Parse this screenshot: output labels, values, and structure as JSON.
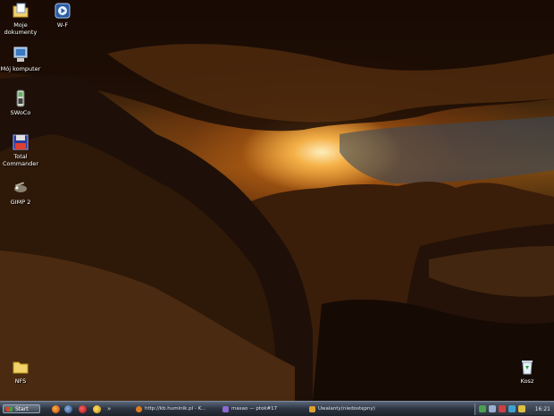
{
  "desktop_icons": [
    {
      "name": "my-documents",
      "label": "Moje\ndokumenty",
      "icon": "folder-documents-icon"
    },
    {
      "name": "wmp",
      "label": "W-F",
      "icon": "media-player-icon"
    },
    {
      "name": "my-computer",
      "label": "Mój komputer",
      "icon": "computer-icon"
    },
    {
      "name": "swoco",
      "label": "SWoCo",
      "icon": "phone-icon"
    },
    {
      "name": "total-commander",
      "label": "Total\nCommander",
      "icon": "floppy-icon"
    },
    {
      "name": "gimp",
      "label": "GIMP 2",
      "icon": "gimp-icon"
    },
    {
      "name": "nfs",
      "label": "NFS",
      "icon": "folder-icon"
    },
    {
      "name": "recycle-bin",
      "label": "Kosz",
      "icon": "recycle-bin-icon"
    }
  ],
  "taskbar": {
    "start_label": "Start",
    "quick_launch": [
      "firefox-icon",
      "network-icon",
      "opera-icon",
      "smiley-icon",
      "arrow-icon"
    ],
    "tasks": [
      {
        "label": "http://kb.huminik.pl - K...",
        "icon": "firefox-icon"
      },
      {
        "label": "masao — ptok#17",
        "icon": "chat-icon"
      },
      {
        "label": "Uwalanty(niedostępny)",
        "icon": "mail-icon"
      }
    ],
    "clock": "16:21"
  }
}
